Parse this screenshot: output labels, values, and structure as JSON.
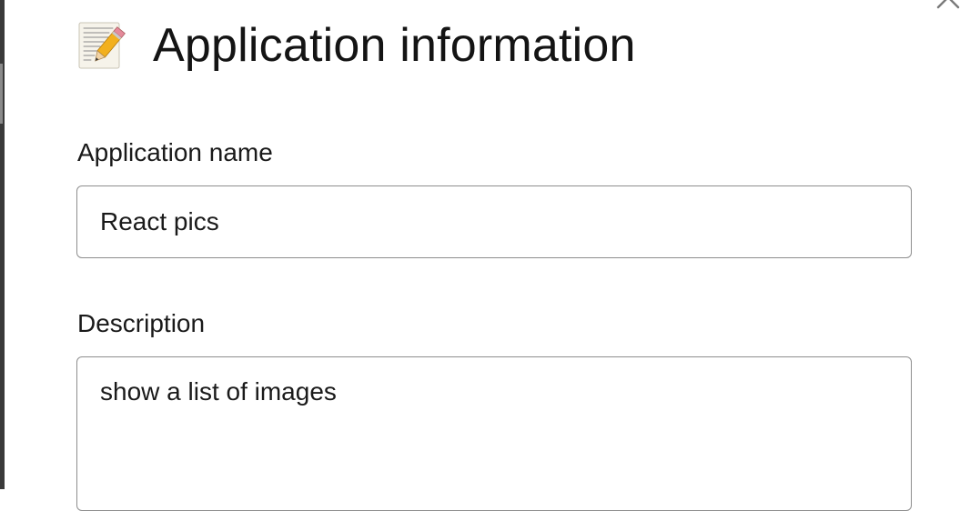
{
  "dialog": {
    "title": "Application information",
    "icon": "memo-icon",
    "close_icon": "close-icon"
  },
  "fields": {
    "name": {
      "label": "Application name",
      "value": "React pics"
    },
    "description": {
      "label": "Description",
      "value": "show a list of images"
    }
  },
  "colors": {
    "border": "#8e8e8e",
    "text": "#1a1a1a",
    "backdrop": "#3a3a3a"
  }
}
